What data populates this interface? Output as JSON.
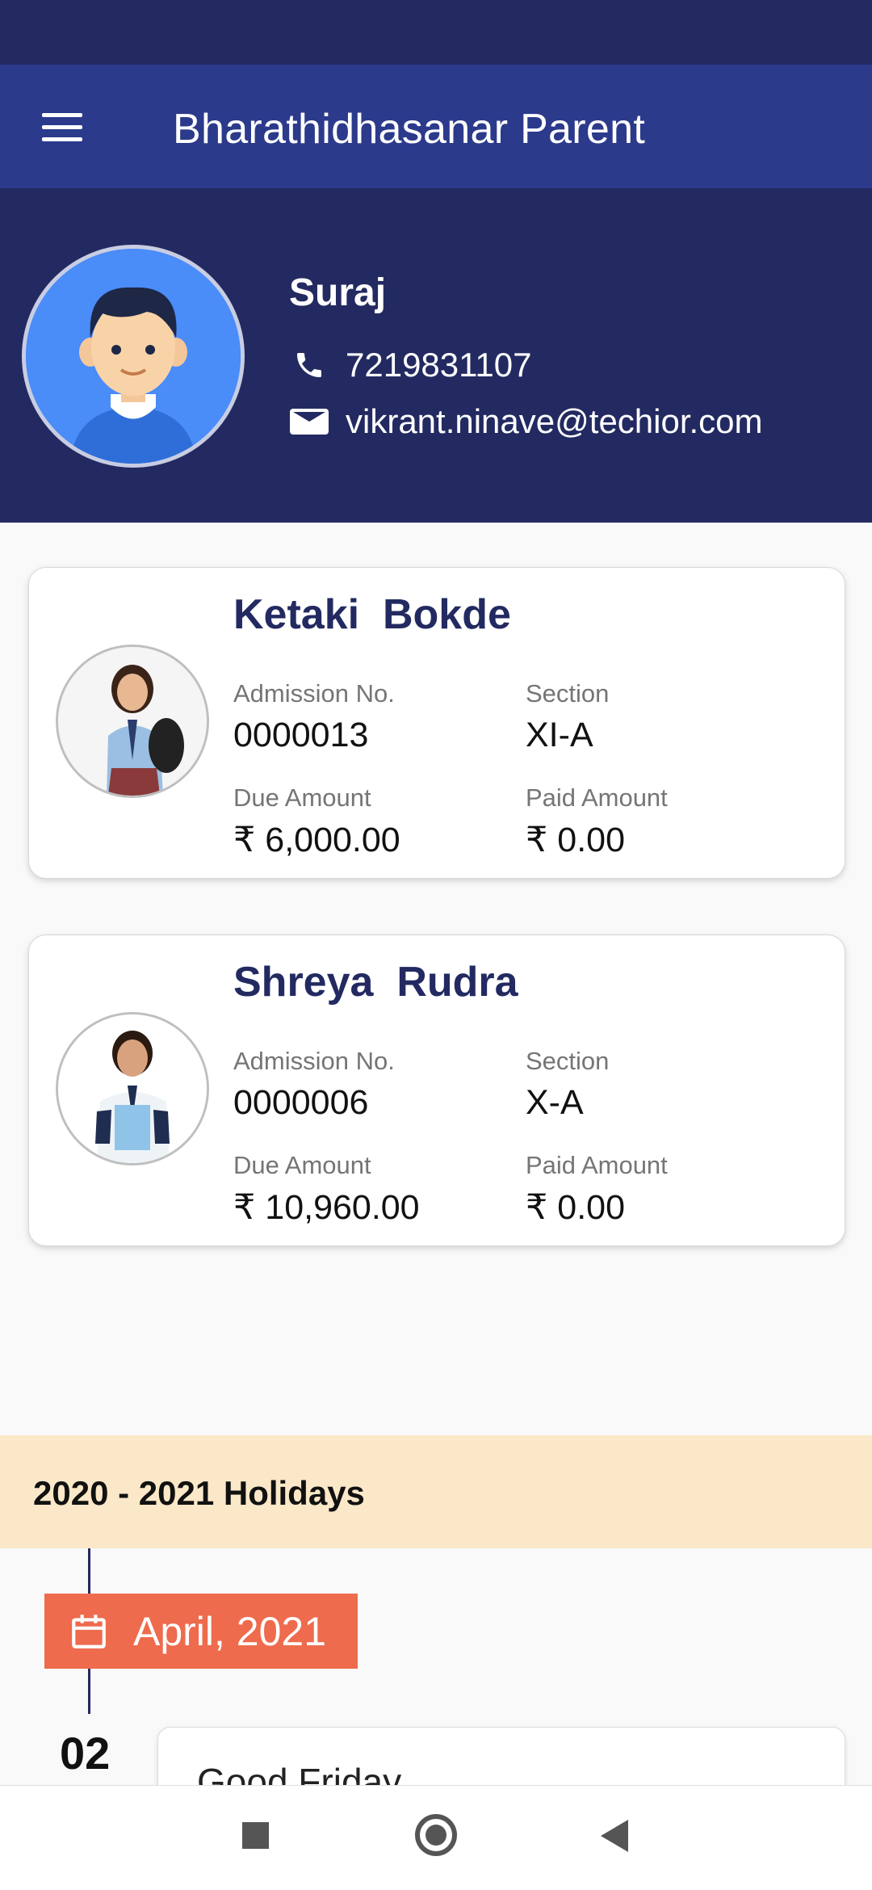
{
  "app": {
    "title": "Bharathidhasanar Parent"
  },
  "profile": {
    "name": "Suraj",
    "phone": "7219831107",
    "email": "vikrant.ninave@techior.com"
  },
  "labels": {
    "admission": "Admission No.",
    "section": "Section",
    "due": "Due Amount",
    "paid": "Paid Amount"
  },
  "students": [
    {
      "name": "Ketaki  Bokde",
      "admission_no": "0000013",
      "section": "XI-A",
      "due_amount": "₹ 6,000.00",
      "paid_amount": "₹ 0.00"
    },
    {
      "name": "Shreya  Rudra",
      "admission_no": "0000006",
      "section": "X-A",
      "due_amount": "₹ 10,960.00",
      "paid_amount": "₹ 0.00"
    }
  ],
  "holidays": {
    "title": "2020 - 2021 Holidays",
    "month": "April, 2021",
    "events": [
      {
        "day": "02",
        "name": "Good Friday"
      }
    ]
  },
  "colors": {
    "primary_dark": "#232a61",
    "app_bar": "#2c3a8c",
    "holiday_header": "#fbe8c8",
    "month_badge": "#ee6b4d"
  }
}
